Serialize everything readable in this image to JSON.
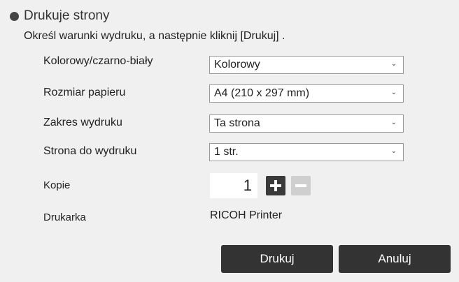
{
  "dialog": {
    "title": "Drukuje strony",
    "instruction": "Określ warunki wydruku, a następnie kliknij [Drukuj] ."
  },
  "fields": {
    "color": {
      "label": "Kolorowy/czarno-biały",
      "value": "Kolorowy"
    },
    "paper_size": {
      "label": "Rozmiar papieru",
      "value": "A4 (210 x 297 mm)"
    },
    "print_range": {
      "label": "Zakres wydruku",
      "value": "Ta strona"
    },
    "page": {
      "label": "Strona do wydruku",
      "value": "1 str."
    },
    "copies": {
      "label": "Kopie",
      "value": "1"
    },
    "printer": {
      "label": "Drukarka",
      "value": "RICOH Printer"
    }
  },
  "buttons": {
    "print_label": "Drukuj",
    "cancel_label": "Anuluj"
  },
  "icons": {
    "bullet": "bullet-circle-icon",
    "dropdown": "chevron-down-icon",
    "increment": "plus-icon",
    "decrement": "minus-icon"
  },
  "colors": {
    "background": "#f0f0f0",
    "button": "#333333",
    "plus_button": "#3a3a3a",
    "minus_button_disabled": "#cfcfcf"
  }
}
